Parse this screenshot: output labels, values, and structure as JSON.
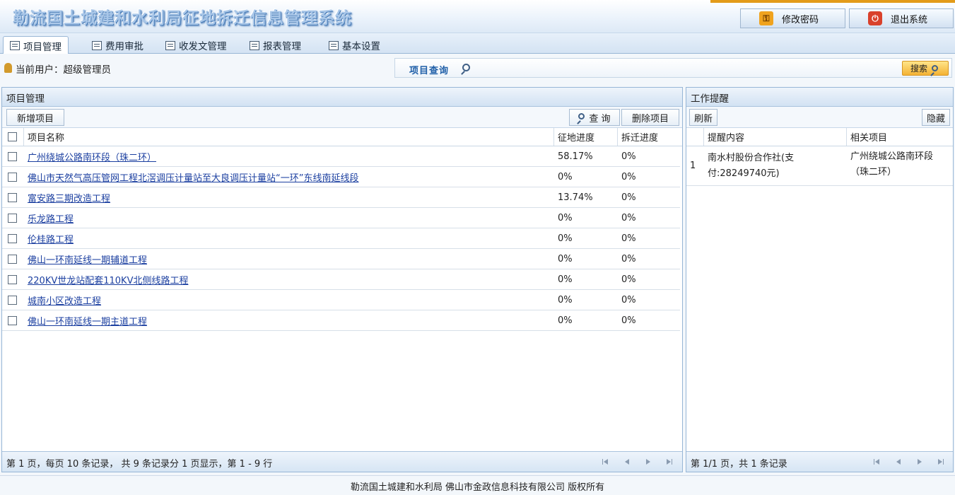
{
  "app": {
    "title": "勒流国土城建和水利局征地拆迁信息管理系统"
  },
  "header": {
    "change_password": "修改密码",
    "logout": "退出系统"
  },
  "tabs": [
    {
      "label": "项目管理",
      "active": true
    },
    {
      "label": "费用审批",
      "active": false
    },
    {
      "label": "收发文管理",
      "active": false
    },
    {
      "label": "报表管理",
      "active": false
    },
    {
      "label": "基本设置",
      "active": false
    }
  ],
  "user": {
    "label": "当前用户：超级管理员"
  },
  "search": {
    "label": "项目查询",
    "button": "搜索"
  },
  "projects": {
    "title": "项目管理",
    "add_button": "新增项目",
    "query_button": "查 询",
    "delete_button": "删除项目",
    "columns": [
      "项目名称",
      "征地进度",
      "拆迁进度"
    ],
    "rows": [
      {
        "name": "广州绕城公路南环段（珠二环）",
        "land": "58.17%",
        "demolition": "0%"
      },
      {
        "name": "佛山市天然气高压管网工程北滘调压计量站至大良调压计量站“一环”东线南延线段",
        "land": "0%",
        "demolition": "0%"
      },
      {
        "name": "富安路三期改造工程",
        "land": "13.74%",
        "demolition": "0%"
      },
      {
        "name": "乐龙路工程",
        "land": "0%",
        "demolition": "0%"
      },
      {
        "name": "伦桂路工程",
        "land": "0%",
        "demolition": "0%"
      },
      {
        "name": "佛山一环南延线一期辅道工程",
        "land": "0%",
        "demolition": "0%"
      },
      {
        "name": "220KV世龙站配套110KV北侧线路工程",
        "land": "0%",
        "demolition": "0%"
      },
      {
        "name": "城南小区改造工程",
        "land": "0%",
        "demolition": "0%"
      },
      {
        "name": "佛山一环南延线一期主道工程",
        "land": "0%",
        "demolition": "0%"
      }
    ],
    "pager": "第 1 页，每页 10 条记录， 共 9 条记录分 1 页显示，第 1 - 9 行"
  },
  "reminders": {
    "title": "工作提醒",
    "refresh_button": "刷新",
    "hide_button": "隐藏",
    "columns": [
      "提醒内容",
      "相关项目"
    ],
    "rows": [
      {
        "index": "1",
        "content_line1": "南水村股份合作社(支",
        "content_line2": "付:28249740元)",
        "project_line1": "广州绕城公路南环段",
        "project_line2": "（珠二环）"
      }
    ],
    "pager": "第 1/1 页，共 1 条记录"
  },
  "footer": {
    "text": "勒流国土城建和水利局 佛山市金政信息科技有限公司 版权所有"
  }
}
